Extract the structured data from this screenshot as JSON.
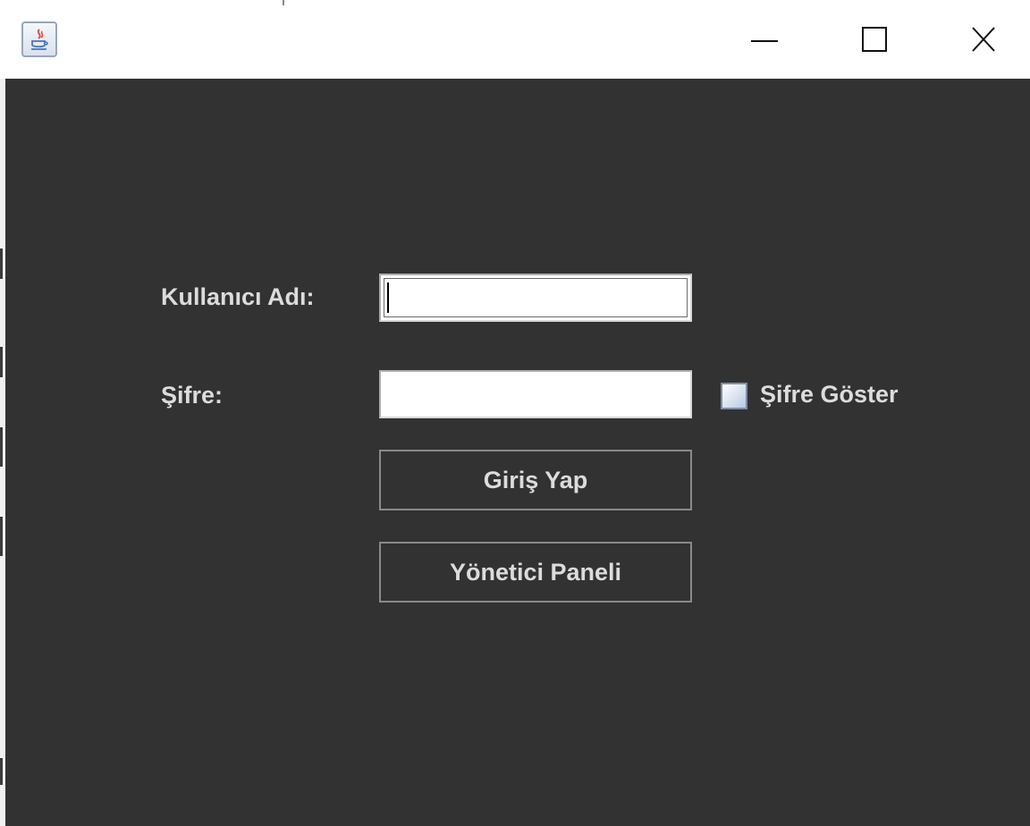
{
  "window": {
    "app_icon": "java-icon",
    "controls": {
      "minimize_icon": "minimize-icon",
      "maximize_icon": "maximize-icon",
      "close_icon": "close-icon"
    }
  },
  "form": {
    "username_label": "Kullanıcı Adı:",
    "username_value": "",
    "password_label": "Şifre:",
    "password_value": "",
    "show_password_label": "Şifre Göster",
    "show_password_checked": false,
    "login_button": "Giriş Yap",
    "admin_button": "Yönetici Paneli"
  },
  "colors": {
    "background": "#323232",
    "text": "#dcdcdc",
    "field": "#ffffff"
  }
}
